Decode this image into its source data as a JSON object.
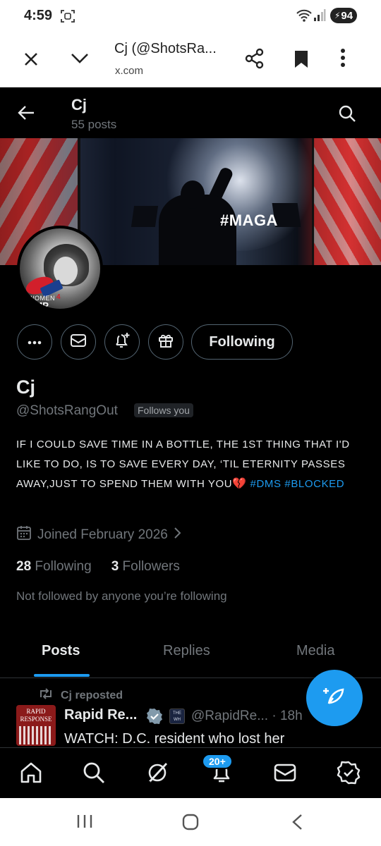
{
  "status_bar": {
    "time": "4:59",
    "battery": "94"
  },
  "browser": {
    "title": "Cj (@ShotsRa...",
    "url": "x.com",
    "icons": [
      "close-icon",
      "chevron-down-icon",
      "share-icon",
      "bookmark-icon",
      "more-vertical-icon"
    ]
  },
  "header": {
    "name": "Cj",
    "posts": "55 posts"
  },
  "banner": {
    "overlay_text": "#MAGA"
  },
  "avatar": {
    "logo_text_1": "WOMEN",
    "logo_num": "4",
    "logo_text_2": "UMP"
  },
  "actions": {
    "follow_label": "Following",
    "icons": [
      "more-horizontal-icon",
      "message-icon",
      "notification-add-icon",
      "gift-icon"
    ]
  },
  "profile": {
    "name": "Cj",
    "handle": "@ShotsRangOut",
    "follows_you": "Follows you",
    "bio_text": "IF I COULD SAVE TIME IN A BOTTLE, THE 1ST THING THAT I'D LIKE TO DO, IS TO SAVE EVERY DAY, ‘TIL ETERNITY PASSES AWAY,JUST TO SPEND THEM WITH YOU",
    "bio_heart": "💔",
    "bio_tag1": "#DMS",
    "bio_tag2": "#BLOCKED",
    "joined": "Joined February 2026",
    "following_count": "28",
    "following_label": "Following",
    "followers_count": "3",
    "followers_label": "Followers",
    "not_followed": "Not followed by anyone you’re following"
  },
  "tabs": [
    {
      "label": "Posts",
      "active": true
    },
    {
      "label": "Replies",
      "active": false
    },
    {
      "label": "Media",
      "active": false
    }
  ],
  "tweet": {
    "repost_label": "Cj reposted",
    "avatar_line1": "RAPID",
    "avatar_line2": "RESPONSE",
    "author_name": "Rapid Re...",
    "affiliate_badge_text": "THE WH",
    "handle_time": "@RapidRe... · 18h",
    "text": "WATCH: D.C. resident who lost her"
  },
  "bottom_nav": {
    "items": [
      "home-icon",
      "search-icon",
      "grok-icon",
      "notifications-icon",
      "messages-icon",
      "verified-icon"
    ],
    "notification_badge": "20+"
  },
  "colors": {
    "accent": "#1d9bf0",
    "background": "#000000",
    "text_primary": "#e7e9ea",
    "text_secondary": "#71767b",
    "border": "#2f3336"
  }
}
